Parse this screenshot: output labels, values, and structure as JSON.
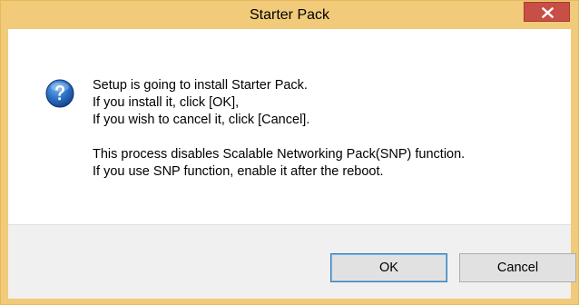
{
  "window": {
    "title": "Starter Pack"
  },
  "titlebar": {
    "close_icon": "close-icon"
  },
  "dialog": {
    "icon": "question-icon",
    "message_lines": [
      "Setup is going to install Starter Pack.",
      "If you install it, click [OK],",
      "If you wish to cancel it, click [Cancel]."
    ],
    "note_lines": [
      "This process disables Scalable Networking Pack(SNP) function.",
      "If you use SNP function, enable it after the reboot."
    ]
  },
  "buttons": {
    "ok_label": "OK",
    "cancel_label": "Cancel"
  },
  "colors": {
    "titlebar": "#f1ca7a",
    "close_button": "#c74f45",
    "question_icon": "#1e5fb0",
    "footer": "#f0f0f0"
  }
}
